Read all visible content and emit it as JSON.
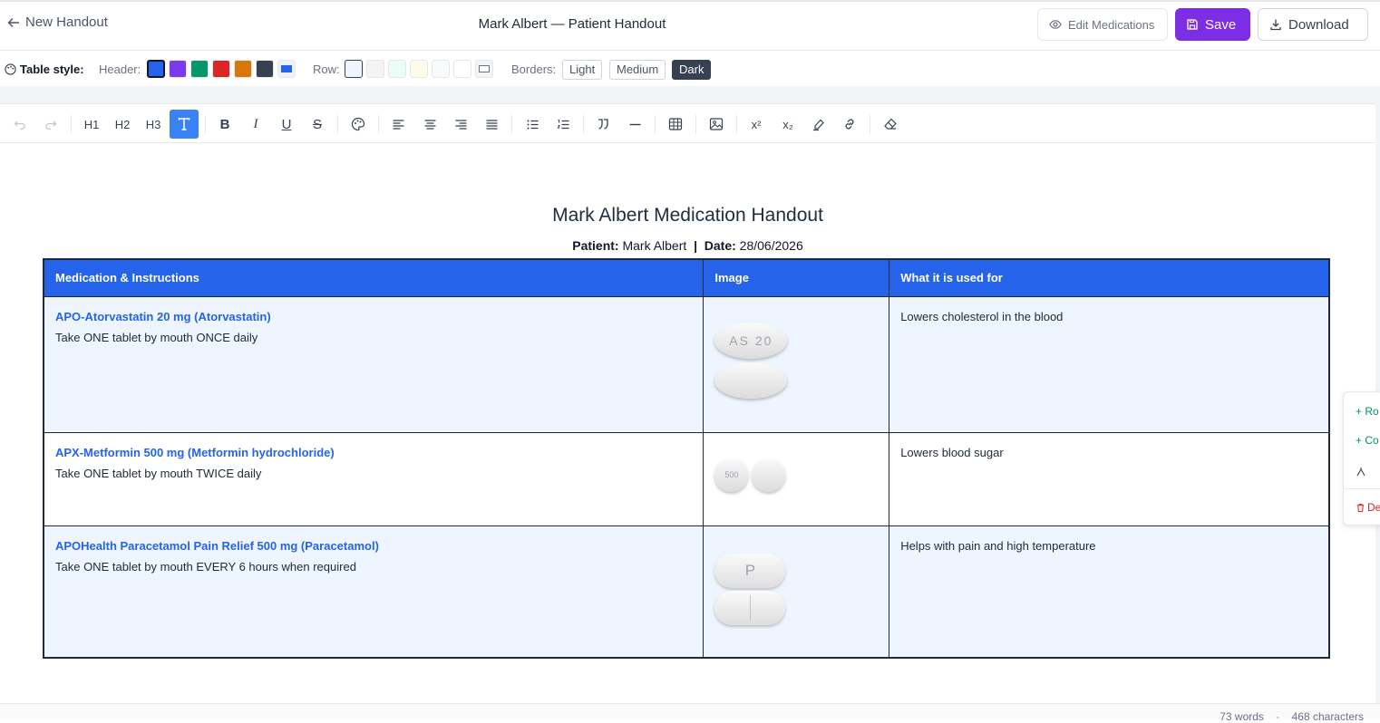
{
  "header": {
    "back_label": "New Handout",
    "title": "Mark Albert — Patient Handout",
    "edit_label": "Edit Medications",
    "save_label": "Save",
    "download_label": "Download"
  },
  "table_style": {
    "label": "Table style:",
    "header_label": "Header:",
    "header_colors": [
      "#2563eb",
      "#7c3aed",
      "#059669",
      "#dc2626",
      "#d97706",
      "#374151"
    ],
    "row_label": "Row:",
    "row_colors": [
      "#eef5ff",
      "#f3f4f6",
      "#ecfdf5",
      "#fefce8",
      "#f9fafb",
      "#ffffff"
    ],
    "borders_label": "Borders:",
    "border_options": [
      "Light",
      "Medium",
      "Dark"
    ],
    "active_border": "Dark"
  },
  "toolbar": {
    "h1": "H1",
    "h2": "H2",
    "h3": "H3",
    "bold": "B",
    "italic": "I",
    "underline": "U",
    "strike": "S",
    "superscript": "x²",
    "subscript": "x₂"
  },
  "document": {
    "title": "Mark Albert Medication Handout",
    "patient_label": "Patient:",
    "patient_name": "Mark Albert",
    "separator": "|",
    "date_label": "Date:",
    "date": "28/06/2026",
    "columns": [
      "Medication & Instructions",
      "Image",
      "What it is used for"
    ],
    "rows": [
      {
        "name": "APO-Atorvastatin 20 mg (Atorvastatin)",
        "instructions": "Take ONE tablet by mouth ONCE daily",
        "imprint": "AS 20",
        "use": "Lowers cholesterol in the blood"
      },
      {
        "name": "APX-Metformin 500 mg (Metformin hydrochloride)",
        "instructions": "Take ONE tablet by mouth TWICE daily",
        "imprint": "500",
        "use": "Lowers blood sugar"
      },
      {
        "name": "APOHealth Paracetamol Pain Relief 500 mg (Paracetamol)",
        "instructions": "Take ONE tablet by mouth EVERY 6 hours when required",
        "imprint": "P",
        "use": "Helps with pain and high temperature"
      }
    ]
  },
  "float_menu": {
    "add_row": "+ Ro",
    "add_col": "+ Co",
    "delete": "De"
  },
  "footer": {
    "words": "73 words",
    "dot": "·",
    "chars": "468 characters"
  }
}
